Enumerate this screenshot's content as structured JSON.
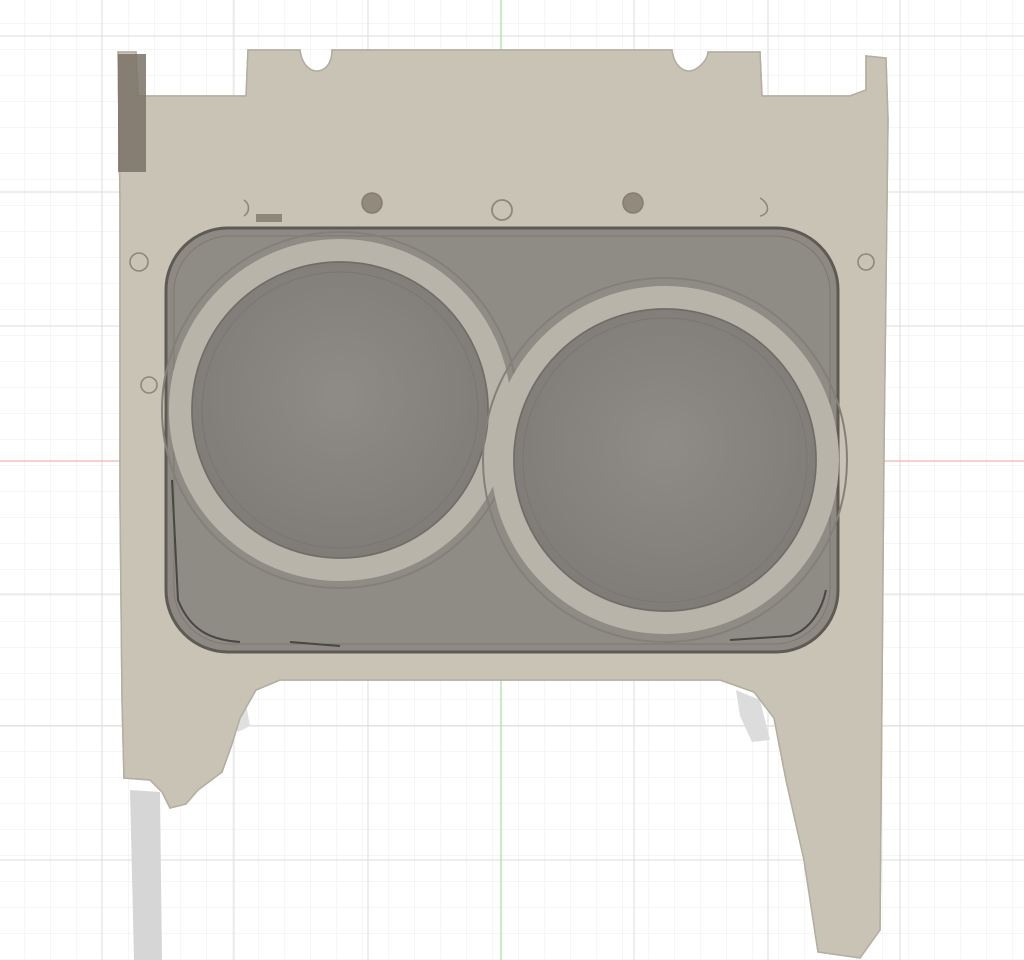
{
  "viewport": {
    "background": "#ffffff",
    "grid_minor_color": "#ececec",
    "grid_major_color": "#dcdcdc",
    "axis_x_color": "#f2b4b4",
    "axis_y_color": "#a8dca8"
  },
  "model": {
    "icon": "scanned-mesh-part",
    "body_color": "#c9c3b6",
    "mesh_line_color": "#9c968a",
    "recess_color": "#8e8a83",
    "ring_color": "#b9b4aa",
    "disc_color": "#878380",
    "shadow_color": "#d3d3d3",
    "dark_patch_color": "#7a7266"
  }
}
